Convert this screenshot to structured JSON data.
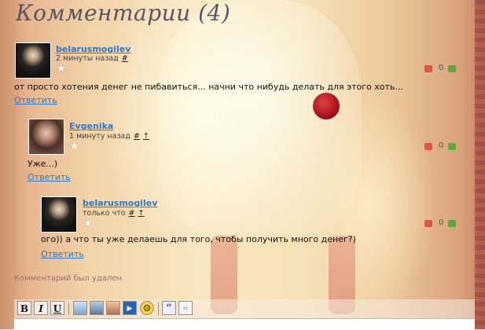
{
  "page": {
    "title": "Комментарии (4)"
  },
  "comments": [
    {
      "user": "belarusmogilev",
      "time": "2 минуты назад",
      "link": "#",
      "text": "от просто хотения денег не пибавиться... начни что нибудь делать для этого хоть...",
      "reply": "Ответить",
      "votes": "0"
    },
    {
      "user": "Evgenika",
      "time": "1 минуту назад",
      "link": "#",
      "up": "↑",
      "text": "Уже...)",
      "reply": "Ответить",
      "votes": "0"
    },
    {
      "user": "belarusmogilev",
      "time": "только что",
      "link": "#",
      "up": "↑",
      "text": "ого)) а что ты уже делаешь для того, чтобы получить много денег?)",
      "reply": "Ответить",
      "votes": "0"
    }
  ],
  "deleted_note": "Комментарий был удален",
  "toolbar": {
    "bold": "B",
    "italic": "I",
    "underline": "U",
    "icons": [
      "image-icon",
      "video-icon",
      "audio-icon",
      "play-icon",
      "smile-icon",
      "quote-icon",
      "link-icon"
    ],
    "quote_glyph": "“",
    "smile_glyph": "☺",
    "play_glyph": "▶",
    "link_glyph": "∞"
  },
  "colors": {
    "link": "#2f79c9",
    "title": "#5a5566",
    "vote_down": "#e0554a",
    "vote_up": "#5ea83c"
  }
}
